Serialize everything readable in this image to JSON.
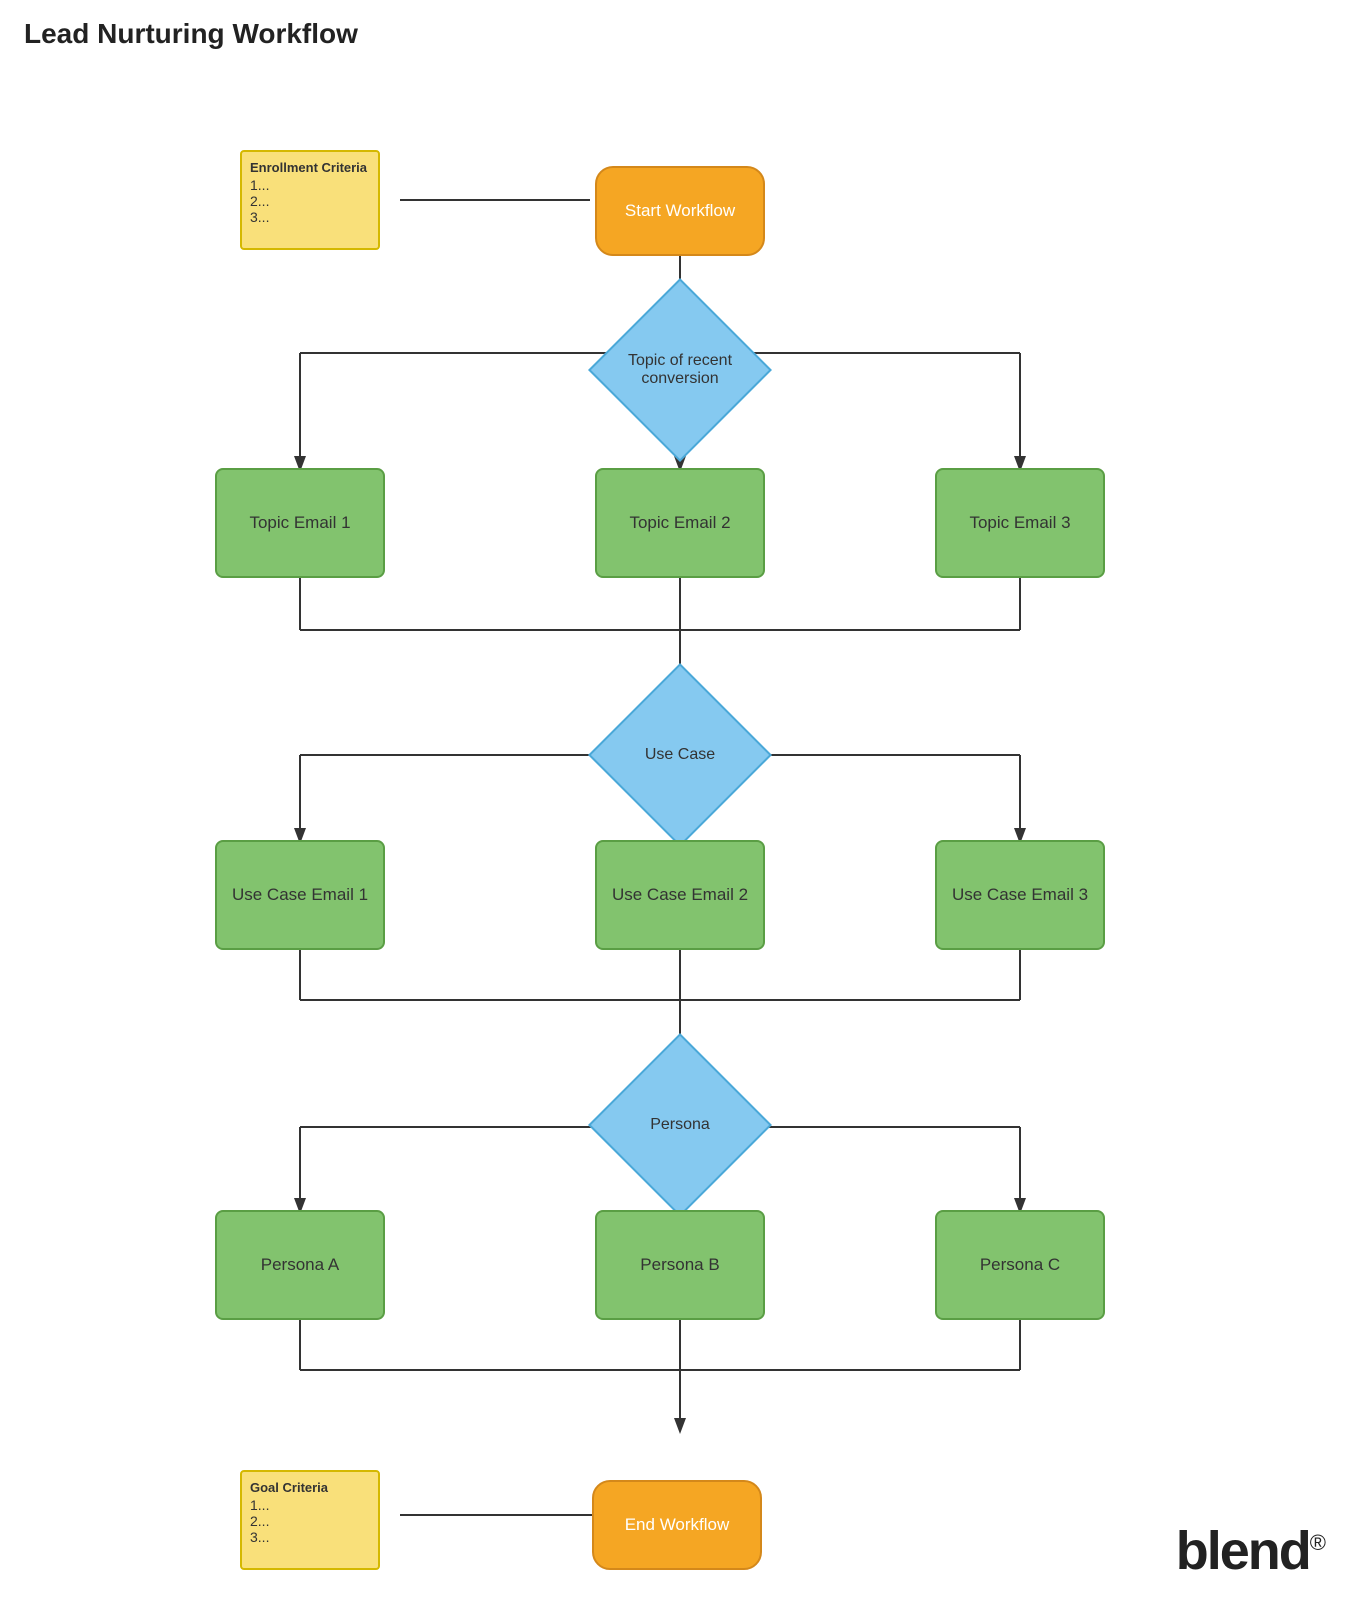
{
  "page": {
    "title": "Lead Nurturing Workflow"
  },
  "nodes": {
    "start": {
      "label": "Start Workflow"
    },
    "end": {
      "label": "End Workflow"
    },
    "topic_decision": {
      "label": "Topic of recent conversion"
    },
    "usecase_decision": {
      "label": "Use Case"
    },
    "persona_decision": {
      "label": "Persona"
    },
    "topic_email_1": {
      "label": "Topic Email 1"
    },
    "topic_email_2": {
      "label": "Topic Email 2"
    },
    "topic_email_3": {
      "label": "Topic Email 3"
    },
    "usecase_email_1": {
      "label": "Use Case Email 1"
    },
    "usecase_email_2": {
      "label": "Use Case Email 2"
    },
    "usecase_email_3": {
      "label": "Use Case Email 3"
    },
    "persona_a": {
      "label": "Persona A"
    },
    "persona_b": {
      "label": "Persona B"
    },
    "persona_c": {
      "label": "Persona C"
    },
    "enrollment": {
      "title": "Enrollment Criteria",
      "lines": [
        "1...",
        "2...",
        "3..."
      ]
    },
    "goal": {
      "title": "Goal Criteria",
      "lines": [
        "1...",
        "2...",
        "3..."
      ]
    }
  },
  "logo": {
    "text": "blend",
    "reg": "®"
  }
}
